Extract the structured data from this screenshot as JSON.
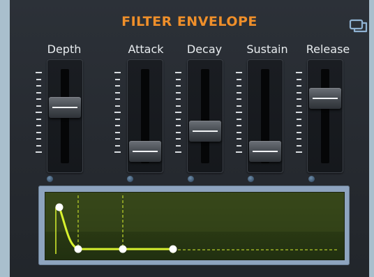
{
  "panel": {
    "title": "FILTER ENVELOPE",
    "accent_color": "#ef8f2a",
    "display_line_color": "#d8f22e",
    "icon": "copy-window-icon"
  },
  "sliders": [
    {
      "label": "Depth",
      "level": 0.6
    },
    {
      "label": "Attack",
      "level": 0.0
    },
    {
      "label": "Decay",
      "level": 0.28
    },
    {
      "label": "Sustain",
      "level": 0.0
    },
    {
      "label": "Release",
      "level": 0.72
    }
  ]
}
